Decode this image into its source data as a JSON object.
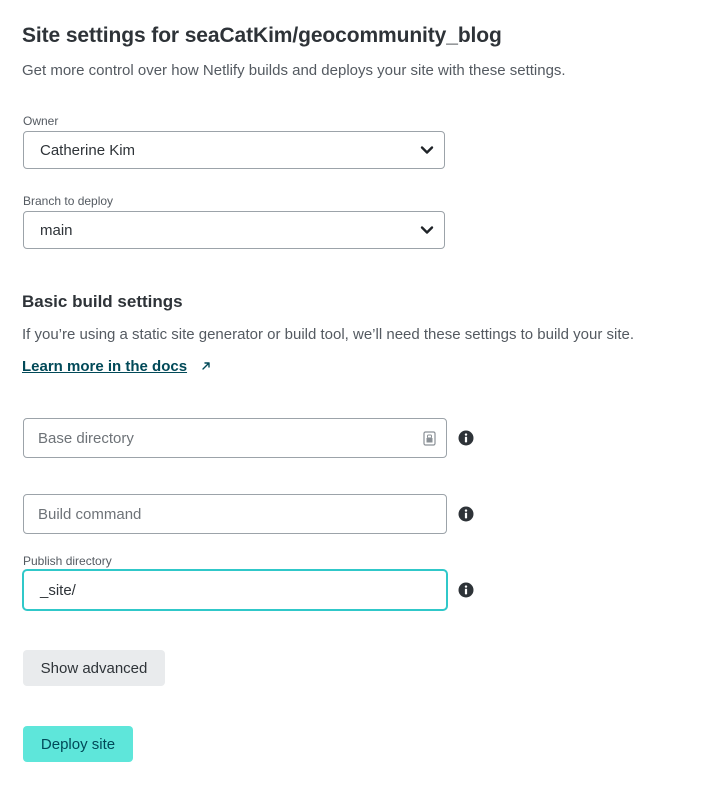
{
  "header": {
    "title": "Site settings for seaCatKim/geocommunity_blog",
    "subtitle": "Get more control over how Netlify builds and deploys your site with these settings."
  },
  "owner": {
    "label": "Owner",
    "value": "Catherine Kim"
  },
  "branch": {
    "label": "Branch to deploy",
    "value": "main"
  },
  "build_settings": {
    "heading": "Basic build settings",
    "description": "If you’re using a static site generator or build tool, we’ll need these settings to build your site.",
    "docs_link": "Learn more in the docs"
  },
  "fields": {
    "base_directory": {
      "placeholder": "Base directory",
      "value": ""
    },
    "build_command": {
      "placeholder": "Build command",
      "value": ""
    },
    "publish_directory": {
      "label": "Publish directory",
      "value": "_site/"
    }
  },
  "buttons": {
    "show_advanced": "Show advanced",
    "deploy": "Deploy site"
  },
  "icons": {
    "chevron": "chevron-down-icon",
    "external": "external-link-icon",
    "info": "info-icon",
    "field_lock": "lock-icon"
  },
  "colors": {
    "accent": "#5ee6da",
    "focus": "#30c8c9",
    "link": "#014958",
    "text": "#2e3338"
  }
}
